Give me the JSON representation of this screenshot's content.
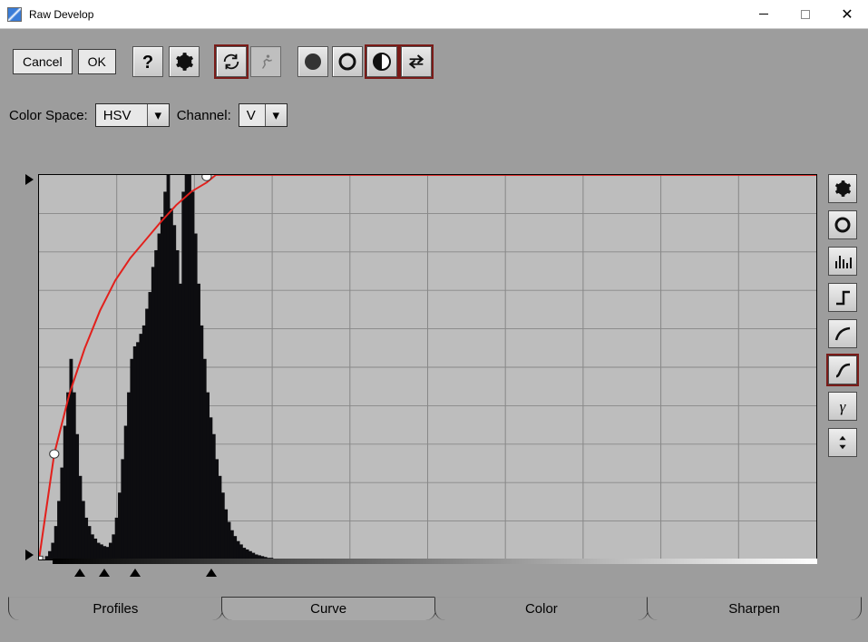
{
  "window": {
    "title": "Raw Develop"
  },
  "toolbar": {
    "cancel_label": "Cancel",
    "ok_label": "OK"
  },
  "options": {
    "colorspace_label": "Color Space:",
    "colorspace_value": "HSV",
    "channel_label": "Channel:",
    "channel_value": "V"
  },
  "tabs": [
    "Profiles",
    "Curve",
    "Color",
    "Sharpen"
  ],
  "active_tab": "Curve",
  "chart_data": {
    "type": "histogram+curve",
    "xlabel": "",
    "ylabel": "",
    "xlim": [
      0,
      255
    ],
    "ylim": [
      0,
      255
    ],
    "grid": true,
    "curve_color": "#e2201c",
    "curve_points_xy": [
      [
        0,
        0
      ],
      [
        5,
        70
      ],
      [
        10,
        110
      ],
      [
        15,
        140
      ],
      [
        20,
        165
      ],
      [
        25,
        185
      ],
      [
        30,
        200
      ],
      [
        35,
        212
      ],
      [
        40,
        224
      ],
      [
        45,
        235
      ],
      [
        50,
        244
      ],
      [
        55,
        250
      ],
      [
        58,
        255
      ],
      [
        255,
        255
      ]
    ],
    "control_points_xy": [
      [
        5,
        70
      ],
      [
        55,
        254
      ]
    ],
    "histogram_bins": [
      0,
      0,
      4,
      10,
      20,
      40,
      70,
      110,
      160,
      200,
      240,
      200,
      150,
      100,
      70,
      50,
      40,
      30,
      25,
      20,
      18,
      16,
      15,
      20,
      30,
      50,
      80,
      120,
      160,
      200,
      240,
      255,
      260,
      270,
      280,
      300,
      320,
      350,
      370,
      390,
      410,
      440,
      460,
      420,
      400,
      370,
      330,
      440,
      460,
      460,
      440,
      390,
      330,
      280,
      240,
      200,
      170,
      150,
      120,
      100,
      80,
      60,
      45,
      35,
      28,
      22,
      18,
      14,
      12,
      10,
      8,
      6,
      5,
      4,
      3,
      2,
      2,
      1,
      1,
      0,
      0,
      0,
      0,
      0,
      0,
      0,
      0,
      0,
      0,
      0,
      0,
      0,
      0,
      0,
      0,
      0,
      0,
      0,
      0,
      0,
      0,
      0,
      0,
      0,
      0,
      0,
      0,
      0,
      0,
      0,
      0,
      0,
      0,
      0,
      0,
      0,
      0,
      0,
      0,
      0,
      0,
      0,
      0,
      0,
      0,
      0,
      0,
      0,
      0,
      0,
      0,
      0,
      0,
      0,
      0,
      0,
      0,
      0,
      0,
      0,
      0,
      0,
      0,
      0,
      0,
      0,
      0,
      0,
      0,
      0,
      0,
      0,
      0,
      0,
      0,
      0,
      0,
      0,
      0,
      0,
      0,
      0,
      0,
      0,
      0,
      0,
      0,
      0,
      0,
      0,
      0,
      0,
      0,
      0,
      0,
      0,
      0,
      0,
      0,
      0,
      0,
      0,
      0,
      0,
      0,
      0,
      0,
      0,
      0,
      0,
      0,
      0,
      0,
      0,
      0,
      0,
      0,
      0,
      0,
      0,
      0,
      0,
      0,
      0,
      0,
      0,
      0,
      0,
      0,
      0,
      0,
      0,
      0,
      0,
      0,
      0,
      0,
      0,
      0,
      0,
      0,
      0,
      0,
      0,
      0,
      0,
      0,
      0,
      0,
      0,
      0,
      0,
      0,
      0,
      0,
      0,
      0,
      0,
      0,
      0,
      0,
      0,
      0,
      0,
      0,
      0,
      0,
      0,
      0,
      0,
      0,
      0,
      0,
      0,
      0,
      0
    ],
    "bottom_markers_x": [
      12,
      20,
      30,
      55
    ]
  }
}
